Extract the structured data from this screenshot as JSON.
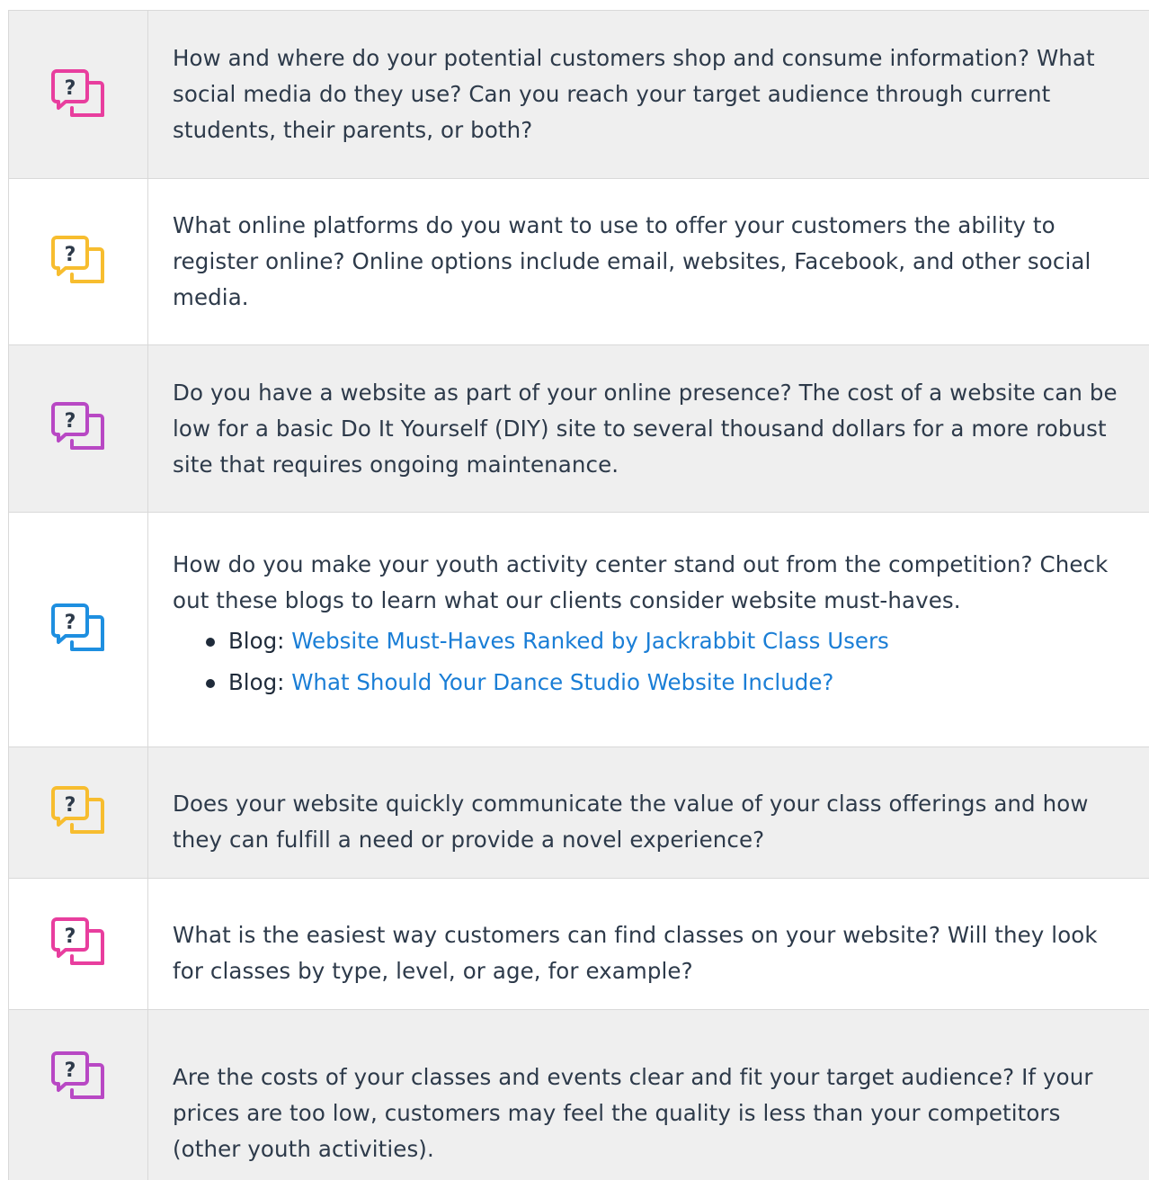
{
  "rows": [
    {
      "icon": "question-chat-icon",
      "icon_color": "#e83e9e",
      "text": "How and where do your potential customers shop and consume information? What social media do they use? Can you reach your target audience through current students, their parents, or both?"
    },
    {
      "icon": "question-chat-icon",
      "icon_color": "#f7bd2f",
      "text": "What online platforms do you want to use to offer your customers the ability to register online? Online options include email, websites, Facebook, and other social media."
    },
    {
      "icon": "question-chat-icon",
      "icon_color": "#b848c4",
      "text": "Do you have a website as part of your online presence? The cost of a website can be low for a basic Do It Yourself (DIY) site to several thousand dollars for a more robust site that requires ongoing maintenance."
    },
    {
      "icon": "question-chat-icon",
      "icon_color": "#1e8fe0",
      "text": "How do you make your youth activity center stand out from the competition? Check out these blogs to learn what our clients consider website must-haves.",
      "bullets": [
        {
          "prefix": "Blog",
          "sep": ": ",
          "link": "Website Must-Haves Ranked by Jackrabbit Class Users"
        },
        {
          "prefix": "Blog",
          "sep": ": ",
          "link": "What Should Your Dance Studio Website Include?"
        }
      ]
    },
    {
      "icon": "question-chat-icon",
      "icon_color": "#f7bd2f",
      "text": "Does your website quickly communicate the value of your class offerings and how they can fulfill a need or provide a novel experience?"
    },
    {
      "icon": "question-chat-icon",
      "icon_color": "#e83e9e",
      "text": "What is the easiest way customers can find classes on your website? Will they look for classes by type, level, or age, for example?"
    },
    {
      "icon": "question-chat-icon",
      "icon_color": "#b848c4",
      "text": "Are the costs of your classes and events clear and fit your target audience? If your prices are too low, customers may feel the quality is less than your competitors (other youth activities)."
    }
  ]
}
